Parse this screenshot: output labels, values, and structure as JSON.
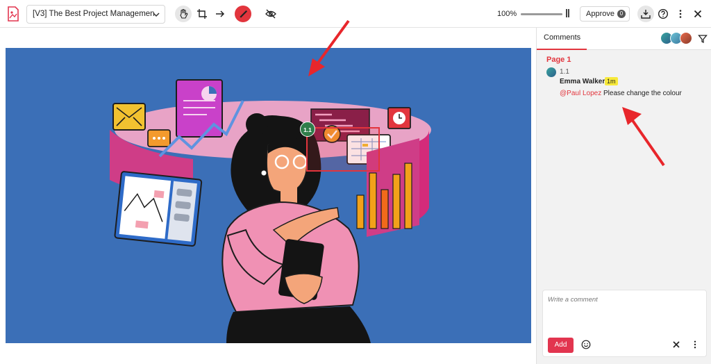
{
  "toolbar": {
    "file_name": "[V3] The Best Project Managemen",
    "zoom_label": "100%",
    "zoom_level_percent": 100,
    "approve_label": "Approve",
    "approve_count": "0",
    "icons": [
      "file-icon",
      "hand-icon",
      "crop-icon",
      "arrow-icon",
      "pen-icon",
      "eye-off-icon",
      "download-icon",
      "help-icon",
      "more-icon",
      "close-icon"
    ]
  },
  "canvas": {
    "pin_label": "1.1",
    "background": "#3b6fb7",
    "highlight_color": "#e2353d"
  },
  "sidebar": {
    "tab_label": "Comments",
    "page_label": "Page 1",
    "comment": {
      "number": "1.1",
      "author": "Emma Walker",
      "time": "1m",
      "mention": "@Paul Lopez",
      "text": "Please change the colour"
    },
    "compose": {
      "placeholder": "Write a comment",
      "add_label": "Add"
    }
  },
  "colors": {
    "accent": "#e2353d",
    "add_button": "#e2354f",
    "time_badge": "#f7e93a"
  }
}
